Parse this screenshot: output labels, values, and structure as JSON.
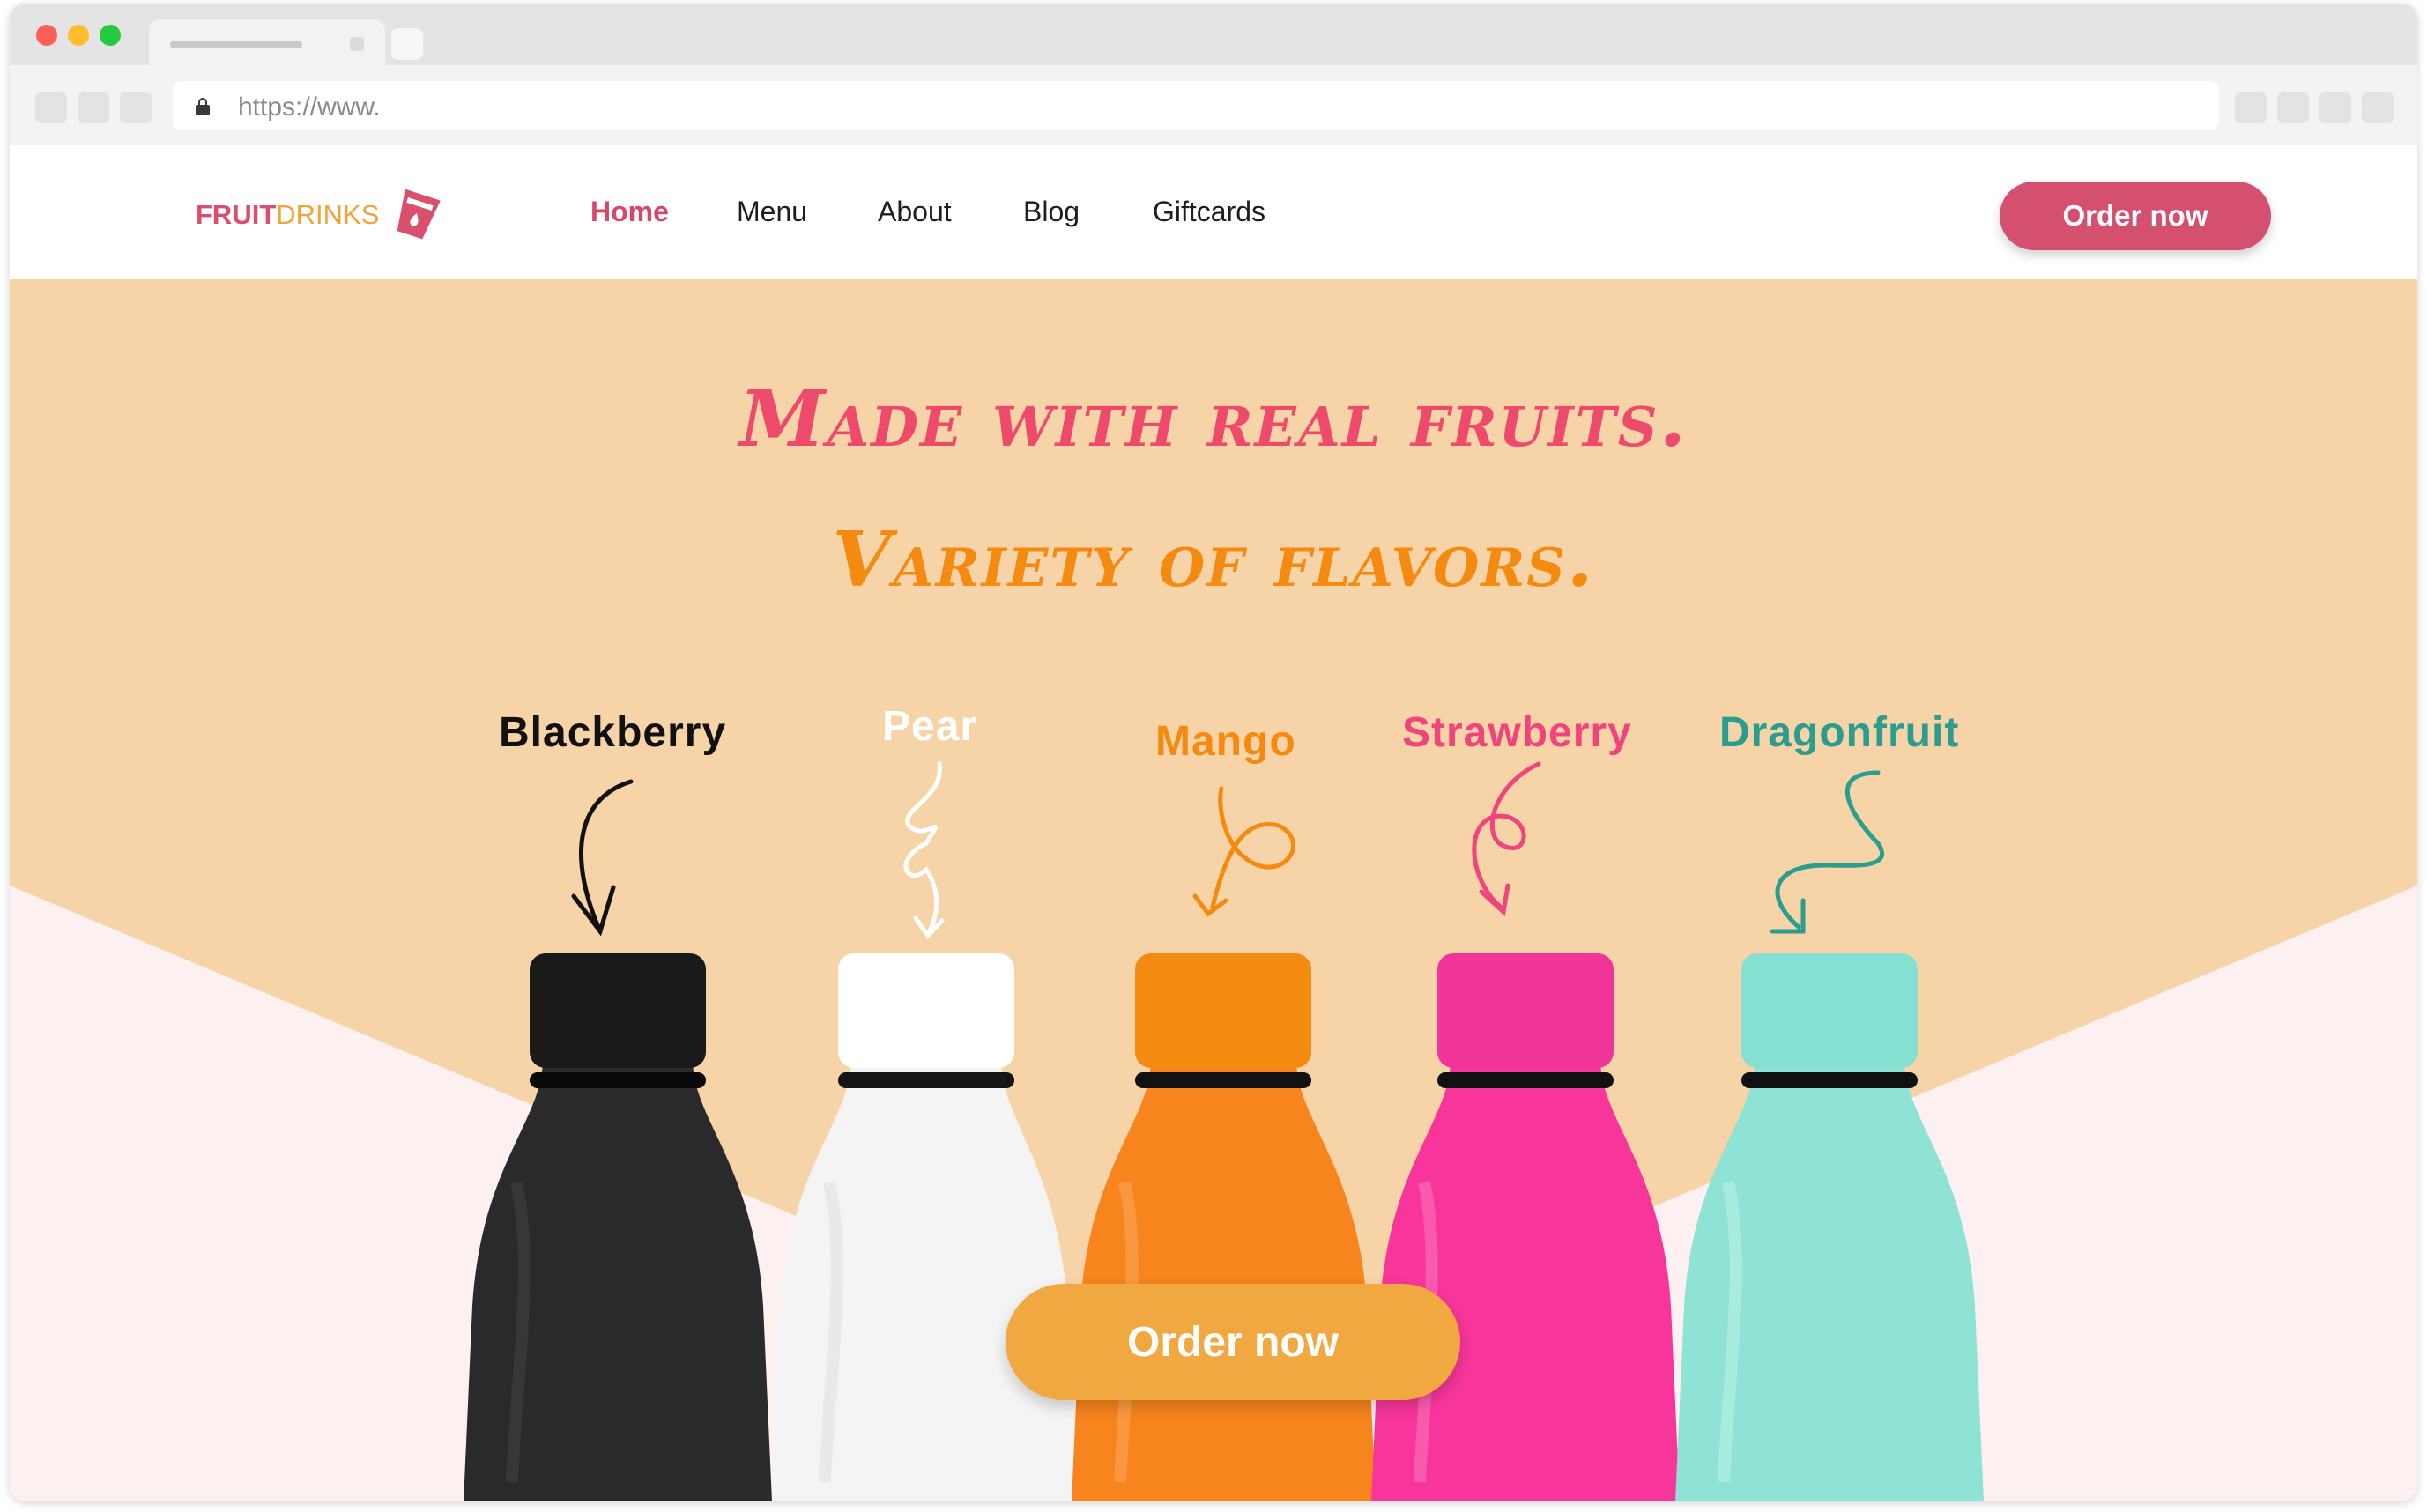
{
  "browser": {
    "url": "https://www.",
    "traffic_lights": [
      "#ff5f57",
      "#febc2e",
      "#28c840"
    ]
  },
  "site": {
    "logo": {
      "part1": "FRUIT",
      "part2": "DRINKS",
      "colors": [
        "#d9506f",
        "#f0a43a"
      ]
    },
    "nav": [
      {
        "label": "Home",
        "active": true
      },
      {
        "label": "Menu",
        "active": false
      },
      {
        "label": "About",
        "active": false
      },
      {
        "label": "Blog",
        "active": false
      },
      {
        "label": "Giftcards",
        "active": false
      }
    ],
    "order_button": "Order now"
  },
  "hero": {
    "headline1": "Made with real fruits.",
    "headline2": "Variety of flavors.",
    "flavors": [
      {
        "name": "Blackberry",
        "color": "#111111",
        "bottle": "#2a2a2a"
      },
      {
        "name": "Pear",
        "color": "#ffffff",
        "bottle": "#f4f4f4"
      },
      {
        "name": "Mango",
        "color": "#f58a11",
        "bottle": "#f7841c"
      },
      {
        "name": "Strawberry",
        "color": "#f0457c",
        "bottle": "#f7359b"
      },
      {
        "name": "Dragonfruit",
        "color": "#2a9d8f",
        "bottle": "#8ee3d4"
      }
    ],
    "order_button": "Order now",
    "background": "#f7d3a8",
    "lower_background": "#fdf0f0"
  }
}
